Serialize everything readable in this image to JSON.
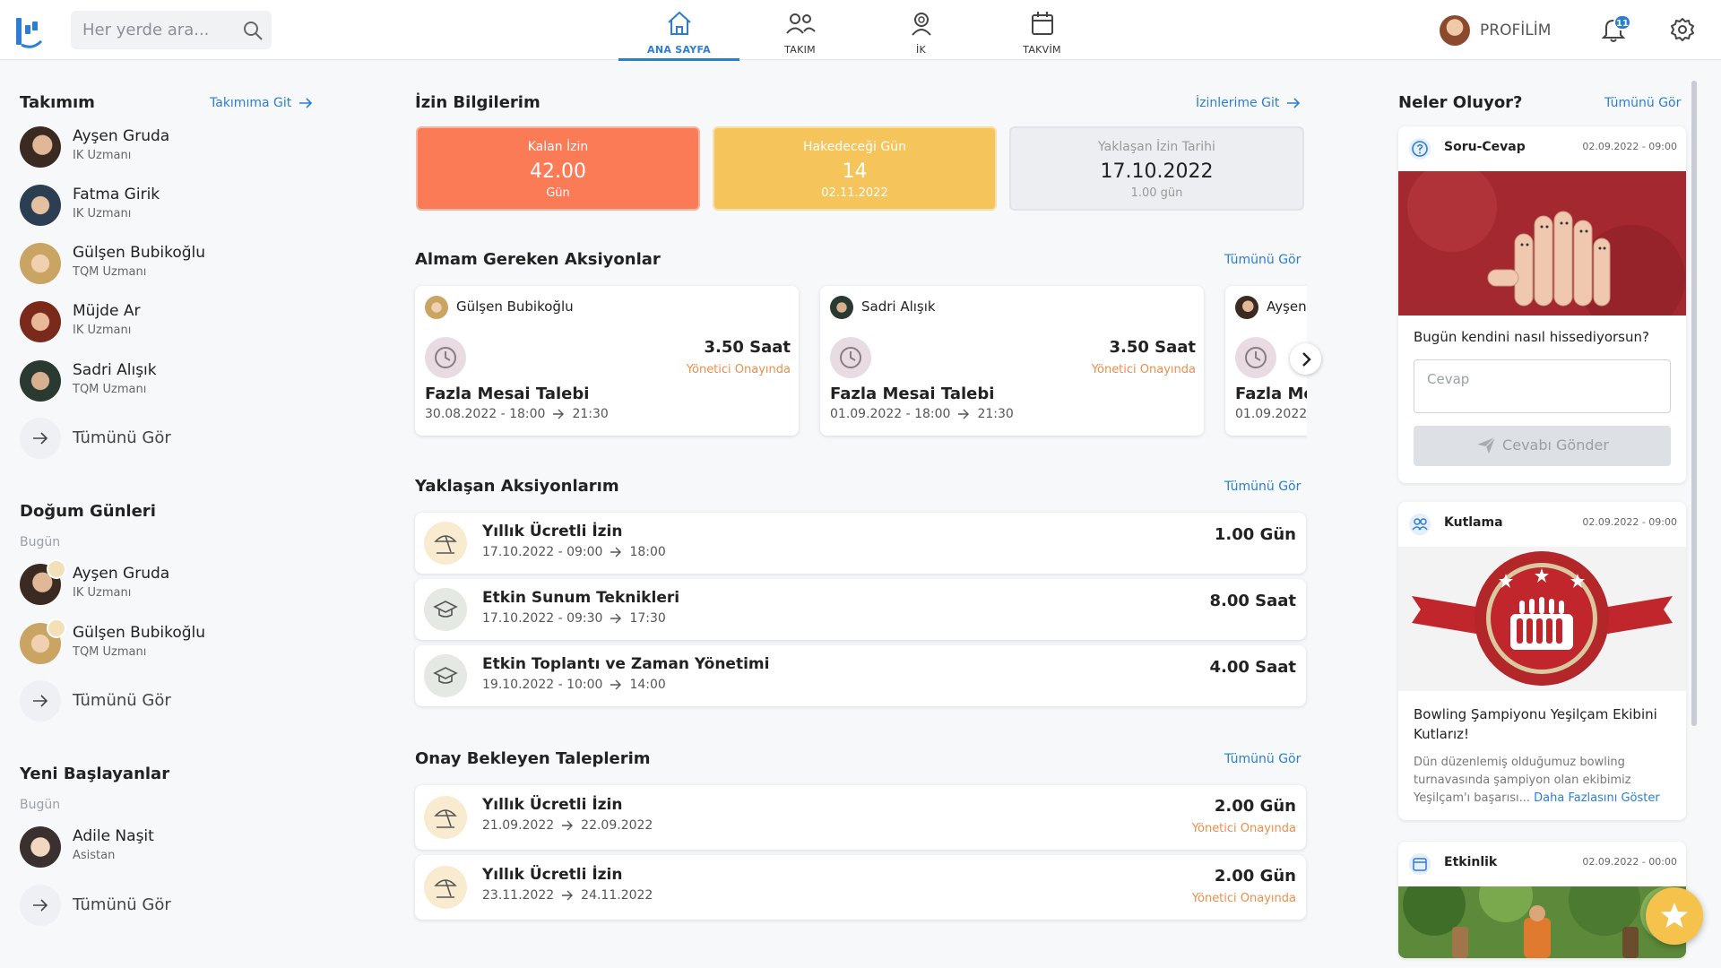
{
  "header": {
    "search_placeholder": "Her yerde ara...",
    "nav": [
      {
        "label": "ANA SAYFA",
        "icon": "home-icon",
        "active": true
      },
      {
        "label": "TAKIM",
        "icon": "team-icon",
        "active": false
      },
      {
        "label": "İK",
        "icon": "hr-icon",
        "active": false
      },
      {
        "label": "TAKVİM",
        "icon": "calendar-icon",
        "active": false
      }
    ],
    "profile_label": "PROFİLİM",
    "notification_count": "11"
  },
  "left": {
    "team": {
      "title": "Takımım",
      "link": "Takımıma Git",
      "members": [
        {
          "name": "Ayşen Gruda",
          "role": "IK Uzmanı"
        },
        {
          "name": "Fatma Girik",
          "role": "IK Uzmanı"
        },
        {
          "name": "Gülşen Bubikoğlu",
          "role": "TQM Uzmanı"
        },
        {
          "name": "Müjde Ar",
          "role": "IK Uzmanı"
        },
        {
          "name": "Sadri Alışık",
          "role": "TQM Uzmanı"
        }
      ],
      "see_all": "Tümünü Gör"
    },
    "birthdays": {
      "title": "Doğum Günleri",
      "sub": "Bugün",
      "people": [
        {
          "name": "Ayşen Gruda",
          "role": "IK Uzmanı"
        },
        {
          "name": "Gülşen Bubikoğlu",
          "role": "TQM Uzmanı"
        }
      ],
      "see_all": "Tümünü Gör"
    },
    "newcomers": {
      "title": "Yeni Başlayanlar",
      "sub": "Bugün",
      "people": [
        {
          "name": "Adile Naşit",
          "role": "Asistan"
        }
      ],
      "see_all": "Tümünü Gör"
    }
  },
  "main": {
    "leave": {
      "title": "İzin Bilgilerim",
      "link": "İzinlerime Git",
      "cards": [
        {
          "label": "Kalan İzin",
          "value": "42.00",
          "sub": "Gün"
        },
        {
          "label": "Hakedeceği Gün",
          "value": "14",
          "sub": "02.11.2022"
        },
        {
          "label": "Yaklaşan İzin Tarihi",
          "value": "17.10.2022",
          "sub": "1.00 gün"
        }
      ]
    },
    "actions": {
      "title": "Almam Gereken Aksiyonlar",
      "link": "Tümünü Gör",
      "cards": [
        {
          "person": "Gülşen Bubikoğlu",
          "hours": "3.50 Saat",
          "status": "Yönetici Onayında",
          "title": "Fazla Mesai Talebi",
          "from": "30.08.2022 - 18:00",
          "to": "21:30"
        },
        {
          "person": "Sadri Alışık",
          "hours": "3.50 Saat",
          "status": "Yönetici Onayında",
          "title": "Fazla Mesai Talebi",
          "from": "01.09.2022 - 18:00",
          "to": "21:30"
        },
        {
          "person": "Ayşen",
          "title": "Fazla Mes",
          "from": "01.09.2022"
        }
      ]
    },
    "upcoming": {
      "title": "Yaklaşan Aksiyonlarım",
      "link": "Tümünü Gör",
      "items": [
        {
          "title": "Yıllık Ücretli İzin",
          "from": "17.10.2022 - 09:00",
          "to": "18:00",
          "amount": "1.00 Gün",
          "icon": "beach-umbrella-icon"
        },
        {
          "title": "Etkin Sunum Teknikleri",
          "from": "17.10.2022 - 09:30",
          "to": "17:30",
          "amount": "8.00 Saat",
          "icon": "graduation-cap-icon"
        },
        {
          "title": "Etkin Toplantı ve Zaman Yönetimi",
          "from": "19.10.2022 - 10:00",
          "to": "14:00",
          "amount": "4.00 Saat",
          "icon": "graduation-cap-icon"
        }
      ]
    },
    "pending": {
      "title": "Onay Bekleyen Taleplerim",
      "link": "Tümünü Gör",
      "items": [
        {
          "title": "Yıllık Ücretli İzin",
          "from": "21.09.2022",
          "to": "22.09.2022",
          "amount": "2.00 Gün",
          "status": "Yönetici Onayında"
        },
        {
          "title": "Yıllık Ücretli İzin",
          "from": "23.11.2022",
          "to": "24.11.2022",
          "amount": "2.00 Gün",
          "status": "Yönetici Onayında"
        }
      ]
    }
  },
  "right": {
    "title": "Neler Oluyor?",
    "link": "Tümünü Gör",
    "posts": [
      {
        "type": "Soru-Cevap",
        "date": "02.09.2022 - 09:00",
        "question": "Bugün kendini nasıl hissediyorsun?",
        "answer_placeholder": "Cevap",
        "send_label": "Cevabı Gönder"
      },
      {
        "type": "Kutlama",
        "date": "02.09.2022 - 09:00",
        "title": "Bowling Şampiyonu Yeşilçam Ekibini Kutlarız!",
        "body": "Dün düzenlemiş olduğumuz bowling turnavasında şampiyon olan ekibimiz Yeşilçam'ı başarısı...",
        "more": "Daha Fazlasını Göster"
      },
      {
        "type": "Etkinlik",
        "date": "02.09.2022 - 00:00"
      }
    ]
  },
  "colors": {
    "accent": "#2b7ed1",
    "leave_remaining": "#fb7b57",
    "leave_accrue": "#f5c45b",
    "leave_upcoming": "#eceef1",
    "status_orange": "#f08d4a"
  }
}
